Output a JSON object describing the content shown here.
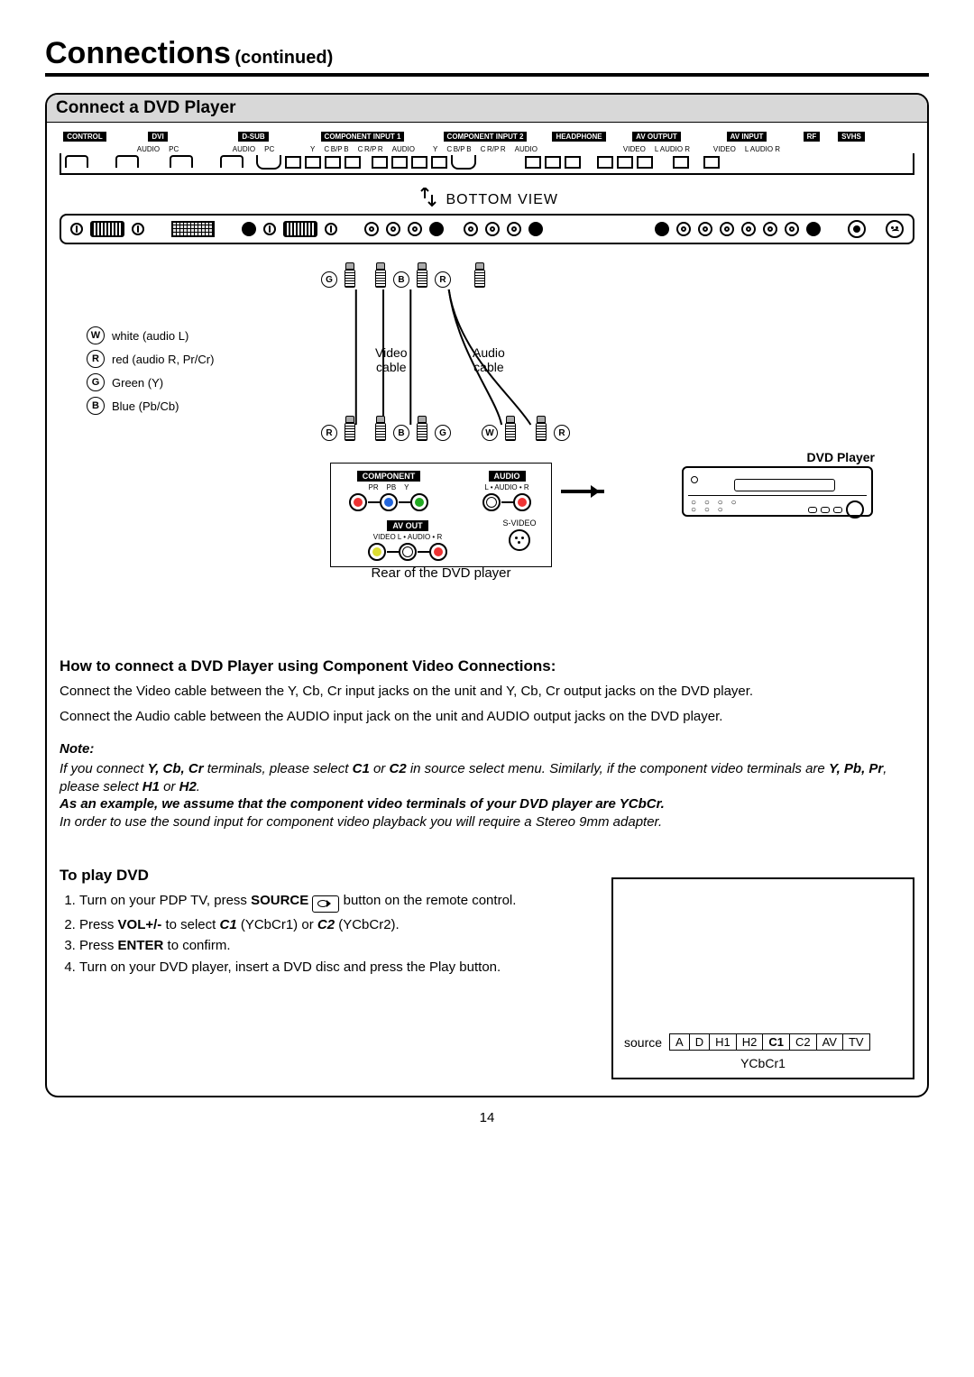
{
  "header": {
    "title": "Connections",
    "continued": "(continued)"
  },
  "card": {
    "title": "Connect a DVD Player"
  },
  "connector_strip": {
    "blocks": [
      {
        "label": "CONTROL"
      },
      {
        "label": "DVI",
        "sub": [
          "AUDIO",
          "",
          "PC"
        ]
      },
      {
        "label": "D-SUB",
        "sub": [
          "AUDIO",
          "",
          "PC"
        ]
      },
      {
        "label": "COMPONENT INPUT 1",
        "sub": [
          "Y",
          "C B/P B",
          "C R/P R",
          "AUDIO"
        ]
      },
      {
        "label": "COMPONENT INPUT 2",
        "sub": [
          "Y",
          "C B/P B",
          "C R/P R",
          "AUDIO"
        ]
      },
      {
        "label": "HEADPHONE"
      },
      {
        "label": "AV OUTPUT",
        "sub": [
          "VIDEO",
          "L  AUDIO  R"
        ]
      },
      {
        "label": "AV INPUT",
        "sub": [
          "VIDEO",
          "L  AUDIO  R"
        ]
      },
      {
        "label": "RF"
      },
      {
        "label": "SVHS"
      }
    ]
  },
  "bottom_view": "BOTTOM VIEW",
  "plug_rows": {
    "top": [
      "G",
      "",
      "",
      "B",
      "",
      "R",
      ""
    ],
    "botL": [
      "R",
      "",
      "",
      "B",
      "",
      "G"
    ],
    "botR": [
      "W",
      "",
      "",
      "R"
    ]
  },
  "legend": [
    {
      "sym": "W",
      "text": "white (audio L)"
    },
    {
      "sym": "R",
      "text": "red (audio R, Pr/Cr)"
    },
    {
      "sym": "G",
      "text": "Green (Y)"
    },
    {
      "sym": "B",
      "text": "Blue (Pb/Cb)"
    }
  ],
  "cable_labels": {
    "video": "Video\ncable",
    "audio": "Audio\ncable"
  },
  "dvd_label": "DVD Player",
  "dvd_rear": {
    "component": {
      "label": "COMPONENT",
      "sub": [
        "PR",
        "PB",
        "Y"
      ]
    },
    "audio": {
      "label": "AUDIO",
      "sub": "L • AUDIO • R"
    },
    "avout": {
      "label": "AV OUT",
      "sub": "VIDEO    L • AUDIO • R"
    },
    "svideo": "S-VIDEO"
  },
  "rear_caption": "Rear of the DVD player",
  "howto_heading": "How to connect a DVD Player using Component Video Connections:",
  "howto_p1": "Connect the Video cable between the Y, Cb, Cr input jacks on the unit and Y, Cb, Cr output jacks on the DVD player.",
  "howto_p2": "Connect the Audio cable between the AUDIO input jack on the unit and AUDIO output jacks on the DVD player.",
  "note_heading": "Note:",
  "note_parts": {
    "a": "If you connect ",
    "b": "Y, Cb, Cr",
    "c": " terminals, please select ",
    "d": "C1",
    "e": " or ",
    "f": "C2",
    "g": " in source select menu. Similarly, if the component video terminals are ",
    "h": "Y, Pb, Pr",
    "i": ", please select ",
    "j": "H1",
    "k": " or ",
    "l": "H2",
    "m": ".",
    "ex": "As an example, we assume that the component video terminals of your DVD player are YCbCr.",
    "n": "In order to use the sound input for component video playback you will require a Stereo 9mm adapter."
  },
  "play_heading": "To play DVD",
  "steps": {
    "s1a": "Turn on your PDP TV, press ",
    "s1b": "SOURCE",
    "s1c": " button on the remote control.",
    "s2a": "Press ",
    "s2b": "VOL+/-",
    "s2c": " to select ",
    "s2d": "C1",
    "s2e": " (YCbCr1) or ",
    "s2f": "C2",
    "s2g": " (YCbCr2).",
    "s3a": "Press ",
    "s3b": "ENTER",
    "s3c": " to confirm.",
    "s4": "Turn on your DVD player, insert a DVD disc and press the Play button."
  },
  "osd": {
    "source_label": "source",
    "options": [
      "A",
      "D",
      "H1",
      "H2",
      "C1",
      "C2",
      "AV",
      "TV"
    ],
    "selected": "C1",
    "sub": "YCbCr1"
  },
  "page_number": "14"
}
